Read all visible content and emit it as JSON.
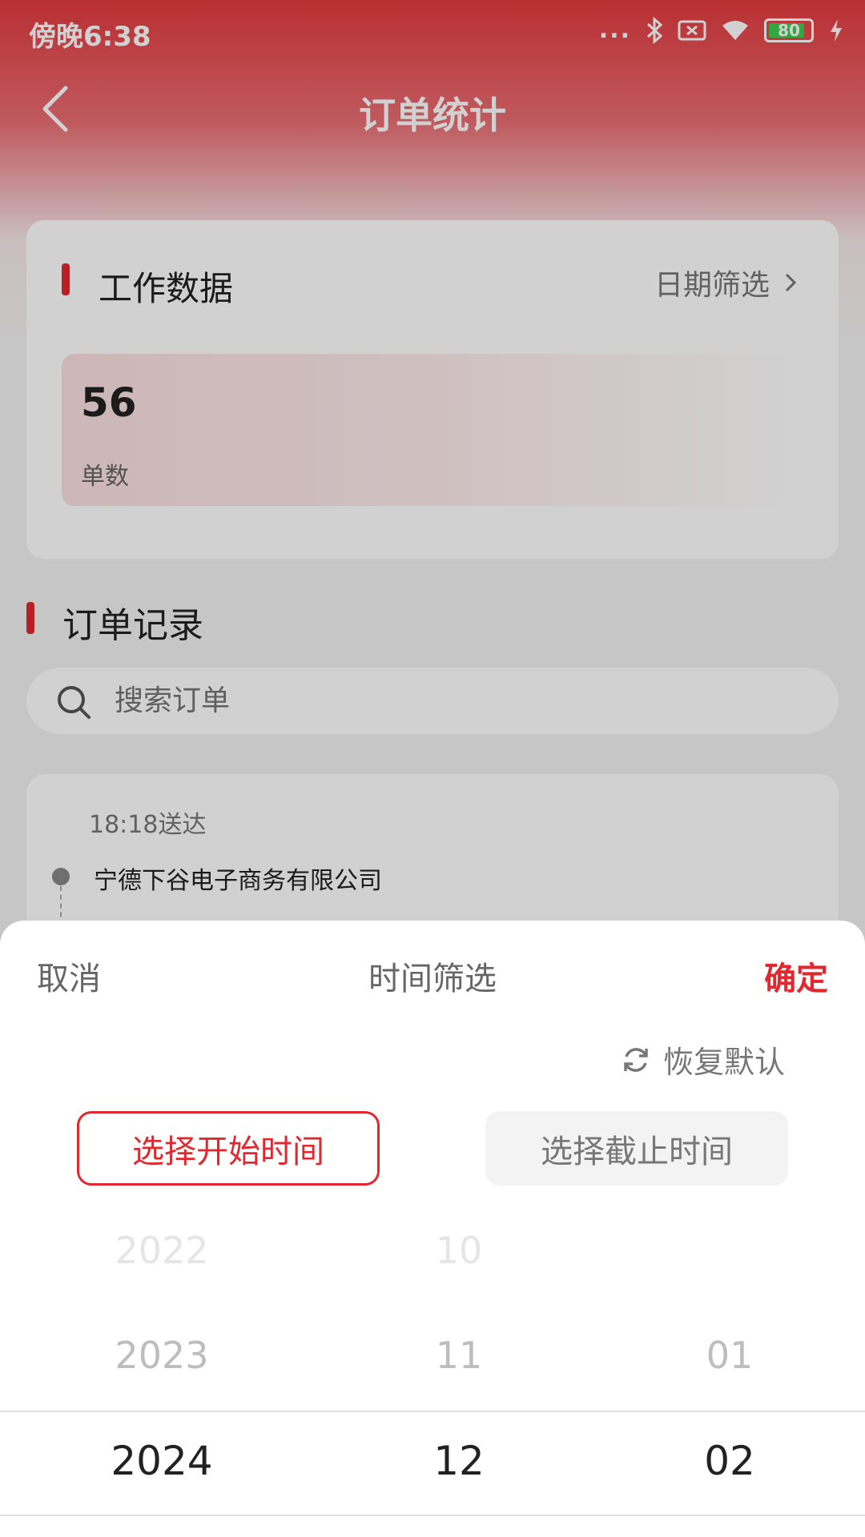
{
  "status_bar": {
    "time": "傍晚6:38",
    "dots": "...",
    "battery": "80",
    "icons": [
      "bluetooth-icon",
      "sim-off-icon",
      "wifi-icon",
      "battery-icon",
      "charging-icon"
    ]
  },
  "nav": {
    "title": "订单统计"
  },
  "work_data": {
    "title": "工作数据",
    "date_filter": "日期筛选",
    "stat_value": "56",
    "stat_label": "单数"
  },
  "orders": {
    "title": "订单记录",
    "search_placeholder": "搜索订单",
    "items": [
      {
        "time": "18:18送达",
        "company": "宁德下谷电子商务有限公司"
      }
    ]
  },
  "sheet": {
    "cancel": "取消",
    "title": "时间筛选",
    "confirm": "确定",
    "reset": "恢复默认",
    "tab_start": "选择开始时间",
    "tab_end": "选择截止时间",
    "years": [
      "2022",
      "2023",
      "2024"
    ],
    "months": [
      "10",
      "11",
      "12"
    ],
    "days": [
      "01",
      "02"
    ]
  },
  "colors": {
    "accent": "#e0282e",
    "header_red": "#e23a3e"
  }
}
